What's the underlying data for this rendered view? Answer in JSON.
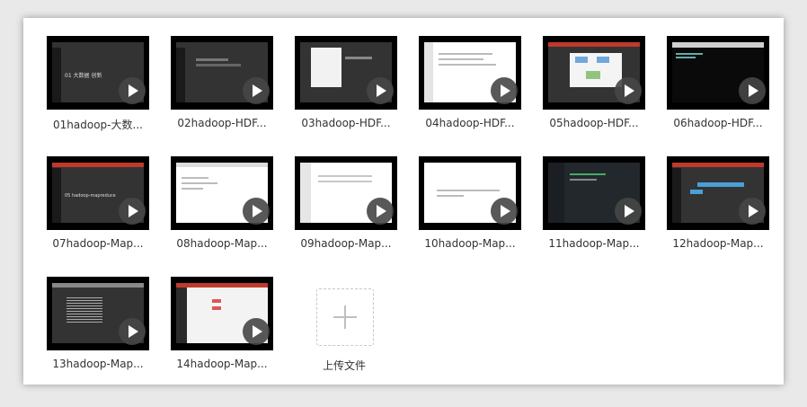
{
  "files": [
    {
      "name": "01hadoop-大数...",
      "screen": "01 大数据 创新"
    },
    {
      "name": "02hadoop-HDF..."
    },
    {
      "name": "03hadoop-HDF..."
    },
    {
      "name": "04hadoop-HDF..."
    },
    {
      "name": "05hadoop-HDF..."
    },
    {
      "name": "06hadoop-HDF..."
    },
    {
      "name": "07hadoop-Map...",
      "screen": "05 hadoop-mapreduce"
    },
    {
      "name": "08hadoop-Map..."
    },
    {
      "name": "09hadoop-Map..."
    },
    {
      "name": "10hadoop-Map..."
    },
    {
      "name": "11hadoop-Map..."
    },
    {
      "name": "12hadoop-Map..."
    },
    {
      "name": "13hadoop-Map..."
    },
    {
      "name": "14hadoop-Map..."
    }
  ],
  "upload": {
    "label": "上传文件"
  },
  "icons": {
    "play": "play-icon",
    "upload": "plus-icon"
  }
}
